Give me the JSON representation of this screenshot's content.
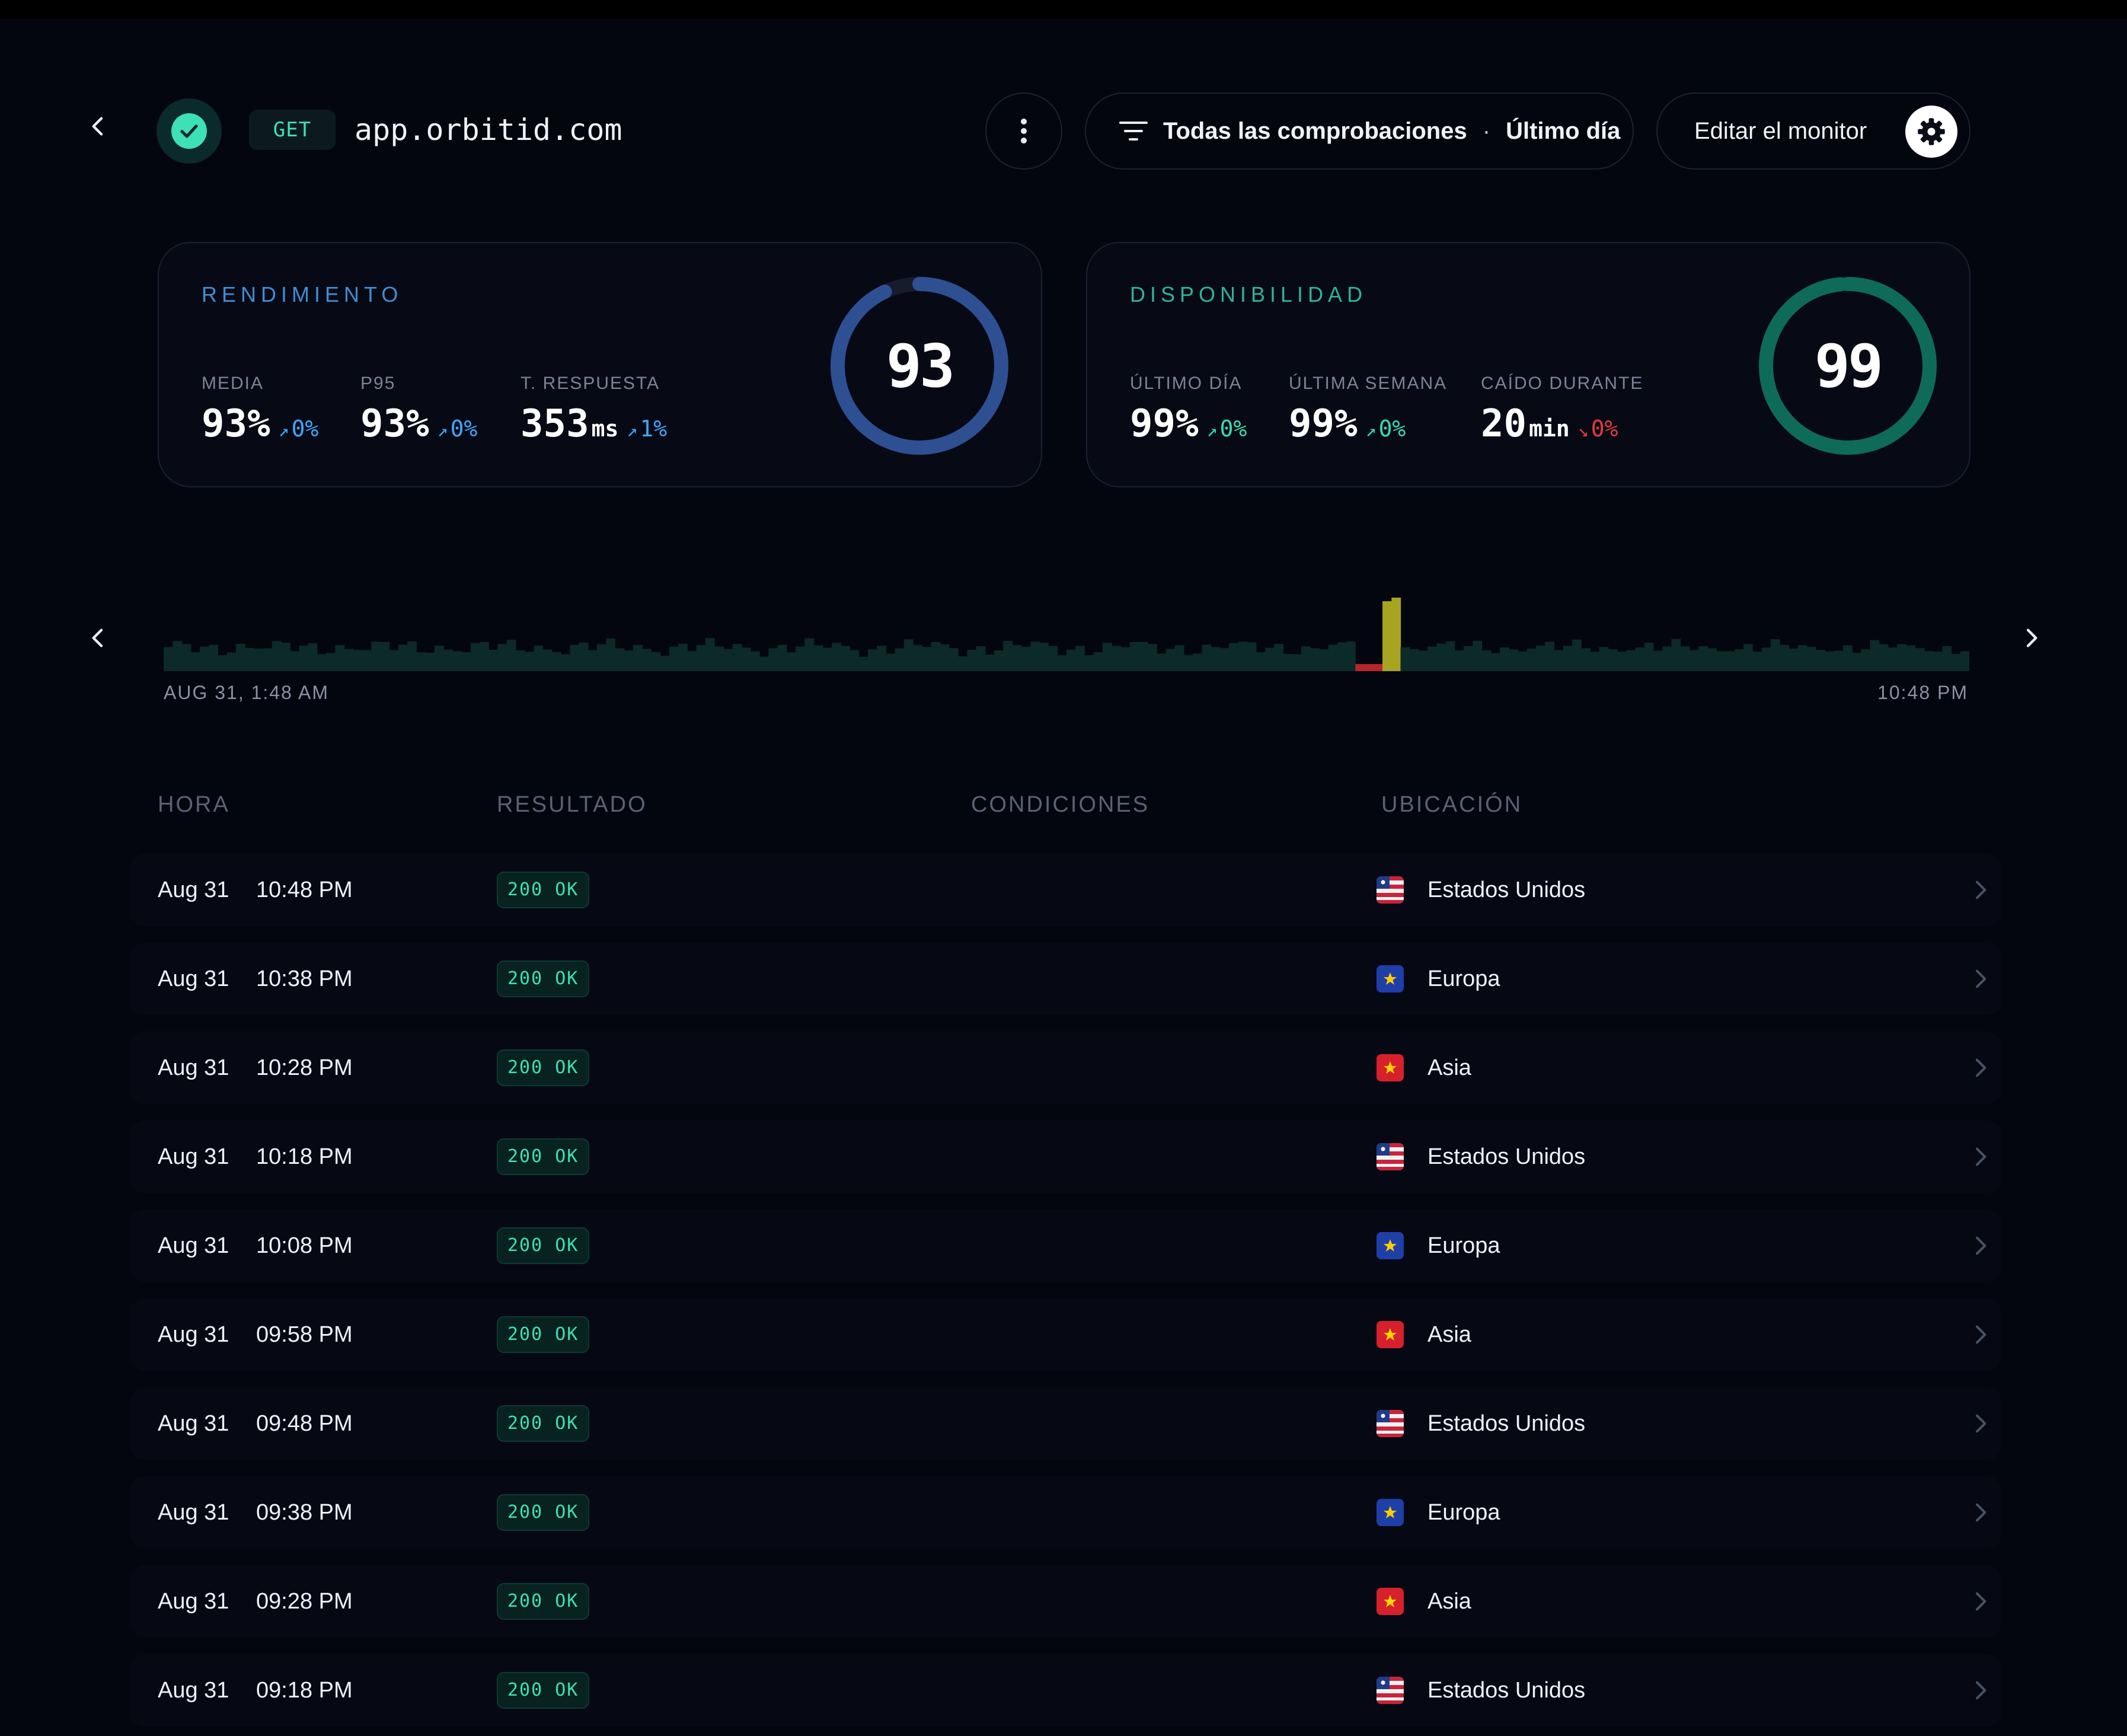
{
  "header": {
    "method": "GET",
    "url": "app.orbitid.com",
    "filter_scope": "Todas las comprobaciones",
    "filter_separator": "·",
    "filter_range": "Último día",
    "edit_label": "Editar el monitor"
  },
  "performance": {
    "title": "RENDIMIENTO",
    "score": "93",
    "score_fraction": 0.93,
    "accent": "#2f4f93",
    "metrics": [
      {
        "label": "MEDIA",
        "value": "93%",
        "unit": "",
        "delta": "0%",
        "trend": "up"
      },
      {
        "label": "P95",
        "value": "93%",
        "unit": "",
        "delta": "0%",
        "trend": "up"
      },
      {
        "label": "T. RESPUESTA",
        "value": "353",
        "unit": "ms",
        "delta": "1%",
        "trend": "up"
      }
    ]
  },
  "availability": {
    "title": "DISPONIBILIDAD",
    "score": "99",
    "score_fraction": 0.985,
    "accent": "#0f6b59",
    "metrics": [
      {
        "label": "ÚLTIMO DÍA",
        "value": "99%",
        "unit": "",
        "delta": "0%",
        "trend": "up"
      },
      {
        "label": "ÚLTIMA SEMANA",
        "value": "99%",
        "unit": "",
        "delta": "0%",
        "trend": "up"
      },
      {
        "label": "CAÍDO DURANTE",
        "value": "20",
        "unit": "min",
        "delta": "0%",
        "trend": "down"
      }
    ]
  },
  "timeline": {
    "start_label": "AUG 31, 1:48 AM",
    "end_label": "10:48 PM",
    "colors": {
      "ok": "#0c2a27",
      "fail": "#b3262b",
      "degraded": "#a8a321"
    }
  },
  "table": {
    "headers": {
      "time": "HORA",
      "result": "RESULTADO",
      "conditions": "CONDICIONES",
      "location": "UBICACIÓN"
    },
    "rows": [
      {
        "date": "Aug 31",
        "time": "10:48 PM",
        "status": "200 OK",
        "flag": "us",
        "location": "Estados Unidos"
      },
      {
        "date": "Aug 31",
        "time": "10:38 PM",
        "status": "200 OK",
        "flag": "eu",
        "location": "Europa"
      },
      {
        "date": "Aug 31",
        "time": "10:28 PM",
        "status": "200 OK",
        "flag": "asia",
        "location": "Asia"
      },
      {
        "date": "Aug 31",
        "time": "10:18 PM",
        "status": "200 OK",
        "flag": "us",
        "location": "Estados Unidos"
      },
      {
        "date": "Aug 31",
        "time": "10:08 PM",
        "status": "200 OK",
        "flag": "eu",
        "location": "Europa"
      },
      {
        "date": "Aug 31",
        "time": "09:58 PM",
        "status": "200 OK",
        "flag": "asia",
        "location": "Asia"
      },
      {
        "date": "Aug 31",
        "time": "09:48 PM",
        "status": "200 OK",
        "flag": "us",
        "location": "Estados Unidos"
      },
      {
        "date": "Aug 31",
        "time": "09:38 PM",
        "status": "200 OK",
        "flag": "eu",
        "location": "Europa"
      },
      {
        "date": "Aug 31",
        "time": "09:28 PM",
        "status": "200 OK",
        "flag": "asia",
        "location": "Asia"
      },
      {
        "date": "Aug 31",
        "time": "09:18 PM",
        "status": "200 OK",
        "flag": "us",
        "location": "Estados Unidos"
      }
    ]
  },
  "icons": {
    "back": "chevron-left-icon",
    "status": "check-icon",
    "menu": "more-vertical-icon",
    "filter": "filter-icon",
    "settings": "gear-icon",
    "row_open": "chevron-right-icon"
  }
}
